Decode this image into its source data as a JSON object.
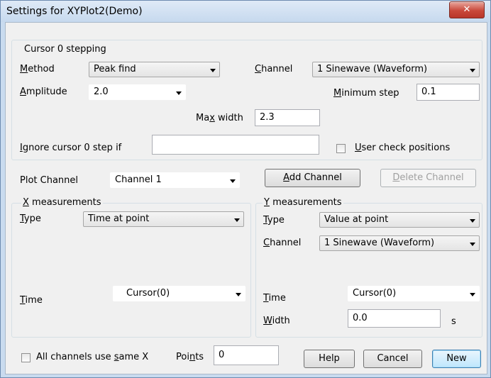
{
  "window": {
    "title": "Settings for XYPlot2(Demo)",
    "close_glyph": "✕",
    "close_icon": "close-icon"
  },
  "stepping": {
    "group_label": "Cursor 0 stepping",
    "method": {
      "label_pre": "",
      "label_u": "M",
      "label_post": "ethod",
      "value": "Peak find"
    },
    "channel": {
      "label_u": "C",
      "label_post": "hannel",
      "value": "1 Sinewave (Waveform)"
    },
    "amplitude": {
      "label_u": "A",
      "label_post": "mplitude",
      "value": "2.0"
    },
    "min_step": {
      "label_u": "M",
      "label_post": "inimum step",
      "value": "0.1"
    },
    "max_width": {
      "label_pre": "Ma",
      "label_u": "x",
      "label_post": " width",
      "value": "2.3"
    },
    "ignore": {
      "label_u": "I",
      "label_post": "gnore cursor 0 step if",
      "value": ""
    },
    "user_check": {
      "label_u": "U",
      "label_post": "ser check positions",
      "checked": false
    }
  },
  "plot_channel": {
    "label": "Plot Channel",
    "value": "Channel 1"
  },
  "buttons": {
    "add_pre": "",
    "add_u": "A",
    "add_post": "dd Channel",
    "delete_pre": "",
    "delete_u": "D",
    "delete_post": "elete Channel",
    "help": "Help",
    "cancel": "Cancel",
    "new": "New"
  },
  "x_meas": {
    "group_label_u": "X",
    "group_label_post": " measurements",
    "type": {
      "label_u": "T",
      "label_post": "ype",
      "value": "Time at point"
    },
    "time": {
      "label_u": "T",
      "label_post": "ime",
      "value": "Cursor(0)"
    }
  },
  "y_meas": {
    "group_label_u": "Y",
    "group_label_post": " measurements",
    "type": {
      "label_u": "T",
      "label_post": "ype",
      "value": "Value at point"
    },
    "channel": {
      "label_u": "C",
      "label_post": "hannel",
      "value": "1 Sinewave (Waveform)"
    },
    "time": {
      "label_u": "T",
      "label_post": "ime",
      "value": "Cursor(0)"
    },
    "width": {
      "label_u": "W",
      "label_post": "idth",
      "value": "0.0",
      "unit": "s"
    }
  },
  "bottom": {
    "all_channels": {
      "label_pre": "All channels use ",
      "label_u": "s",
      "label_post": "ame X",
      "checked": false
    },
    "points": {
      "label_pre": "Poi",
      "label_u": "n",
      "label_post": "ts",
      "value": "0"
    }
  }
}
